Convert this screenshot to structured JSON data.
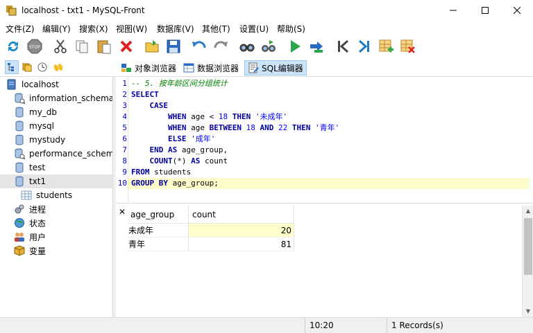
{
  "window": {
    "title": "localhost - txt1 - MySQL-Front"
  },
  "menu": [
    "文件(Z)",
    "编辑(Y)",
    "搜索(X)",
    "视图(W)",
    "数据库(V)",
    "其他(T)",
    "设置(U)",
    "帮助(S)"
  ],
  "toolbar": {
    "icons": [
      "refresh-icon",
      "stop-icon",
      "cut-icon",
      "copy-icon",
      "paste-icon",
      "delete-icon",
      "open-icon",
      "save-icon",
      "undo-icon",
      "redo-icon",
      "find-icon",
      "replace-icon",
      "run-icon",
      "run-line-icon",
      "first-record-icon",
      "last-record-icon",
      "insert-record-icon",
      "delete-record-icon"
    ]
  },
  "views": {
    "object_browser": "对象浏览器",
    "data_browser": "数据浏览器",
    "sql_editor": "SQL编辑器"
  },
  "tree": {
    "root": "localhost",
    "databases": [
      "information_schema",
      "my_db",
      "mysql",
      "mystudy",
      "performance_schema",
      "test",
      "txt1"
    ],
    "selected": "txt1",
    "tables": [
      "students"
    ],
    "extras": [
      "进程",
      "状态",
      "用户",
      "变量"
    ]
  },
  "editor": {
    "line_numbers": [
      "1",
      "2",
      "3",
      "4",
      "5",
      "6",
      "7",
      "8",
      "9",
      "10"
    ],
    "current_line": 10
  },
  "results": {
    "columns": [
      "age_group",
      "count"
    ],
    "rows": [
      {
        "age_group": "未成年",
        "count": "20"
      },
      {
        "age_group": "青年",
        "count": "81"
      }
    ]
  },
  "status": {
    "position": "10:20",
    "records": "1 Records(s)"
  },
  "colors": {
    "keyword": "#0000a0",
    "comment": "#008000",
    "string": "#0000ff",
    "current_line": "#fffccc",
    "accent": "#cce4f7"
  }
}
